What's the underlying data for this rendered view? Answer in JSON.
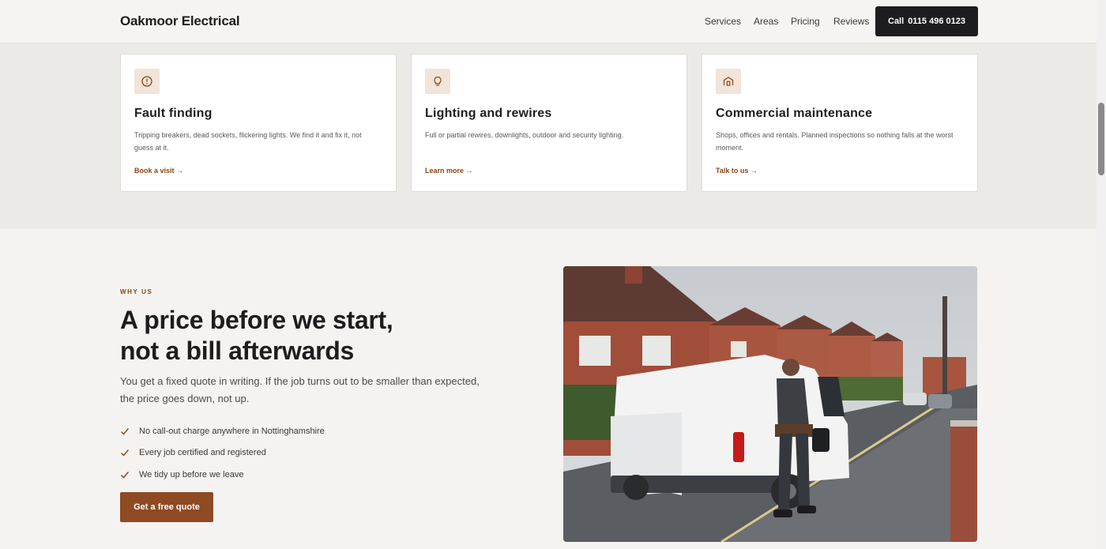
{
  "header": {
    "brand": "Oakmoor Electrical",
    "nav": [
      "Services",
      "Areas",
      "Pricing",
      "Reviews"
    ],
    "call_label": "Call",
    "call_number": "0115 496 0123"
  },
  "services": [
    {
      "icon": "alert-circle-icon",
      "title": "Fault finding",
      "desc": "Tripping breakers, dead sockets, flickering lights. We find it and fix it, not guess at it.",
      "link": "Book a visit →"
    },
    {
      "icon": "lightbulb-icon",
      "title": "Lighting and rewires",
      "desc": "Full or partial rewires, downlights, outdoor and security lighting.",
      "link": "Learn more →"
    },
    {
      "icon": "building-icon",
      "title": "Commercial maintenance",
      "desc": "Shops, offices and rentals. Planned inspections so nothing falls at the worst moment.",
      "link": "Talk to us →"
    }
  ],
  "why": {
    "eyebrow": "WHY US",
    "headline_1": "A price before we start,",
    "headline_2": "not a bill afterwards",
    "lede": "You get a fixed quote in writing. If the job turns out to be smaller than expected, the price goes down, not up.",
    "points": [
      "No call-out charge anywhere in Nottinghamshire",
      "Every job certified and registered",
      "We tidy up before we leave"
    ],
    "cta": "Get a free quote"
  },
  "colors": {
    "accent": "#8e4a22",
    "dark": "#1d1d20",
    "icon_bg": "#f2e4d8"
  }
}
